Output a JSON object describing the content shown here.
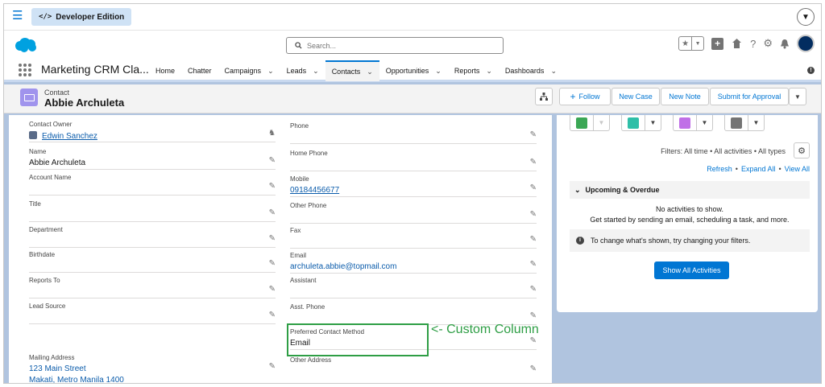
{
  "dev_bar": {
    "edition_label": "Developer Edition",
    "code_glyph": "</>"
  },
  "header": {
    "search_placeholder": "Search..."
  },
  "nav": {
    "app_name": "Marketing CRM Cla...",
    "tabs": [
      {
        "label": "Home",
        "has_menu": false,
        "active": false
      },
      {
        "label": "Chatter",
        "has_menu": false,
        "active": false
      },
      {
        "label": "Campaigns",
        "has_menu": true,
        "active": false
      },
      {
        "label": "Leads",
        "has_menu": true,
        "active": false
      },
      {
        "label": "Contacts",
        "has_menu": true,
        "active": true
      },
      {
        "label": "Opportunities",
        "has_menu": true,
        "active": false
      },
      {
        "label": "Reports",
        "has_menu": true,
        "active": false
      },
      {
        "label": "Dashboards",
        "has_menu": true,
        "active": false
      }
    ]
  },
  "record": {
    "object_label": "Contact",
    "name": "Abbie Archuleta",
    "buttons": {
      "follow": "Follow",
      "new_case": "New Case",
      "new_note": "New Note",
      "submit": "Submit for Approval"
    }
  },
  "fields": {
    "contact_owner": {
      "label": "Contact Owner",
      "value": "Edwin Sanchez"
    },
    "phone": {
      "label": "Phone",
      "value": ""
    },
    "name": {
      "label": "Name",
      "value": "Abbie Archuleta"
    },
    "home_phone": {
      "label": "Home Phone",
      "value": ""
    },
    "account_name": {
      "label": "Account Name",
      "value": ""
    },
    "mobile": {
      "label": "Mobile",
      "value": "09184456677"
    },
    "title": {
      "label": "Title",
      "value": ""
    },
    "other_phone": {
      "label": "Other Phone",
      "value": ""
    },
    "department": {
      "label": "Department",
      "value": ""
    },
    "fax": {
      "label": "Fax",
      "value": ""
    },
    "birthdate": {
      "label": "Birthdate",
      "value": ""
    },
    "email": {
      "label": "Email",
      "value": "archuleta.abbie@topmail.com"
    },
    "reports_to": {
      "label": "Reports To",
      "value": ""
    },
    "assistant": {
      "label": "Assistant",
      "value": ""
    },
    "lead_source": {
      "label": "Lead Source",
      "value": ""
    },
    "asst_phone": {
      "label": "Asst. Phone",
      "value": ""
    },
    "preferred_contact": {
      "label": "Preferred Contact Method",
      "value": "Email"
    },
    "mailing_address": {
      "label": "Mailing Address",
      "line1": "123 Main Street",
      "line2": "Makati, Metro Manila 1400"
    },
    "other_address": {
      "label": "Other Address",
      "value": ""
    }
  },
  "annotation": {
    "callout": "<- Custom Column",
    "color": "#2e9e45"
  },
  "activity": {
    "filters_text": "Filters: All time • All activities • All types",
    "refresh": "Refresh",
    "expand_all": "Expand All",
    "view_all": "View All",
    "separator": "•",
    "upcoming": "Upcoming & Overdue",
    "no_activities": "No activities to show.",
    "get_started": "Get started by sending an email, scheduling a task, and more.",
    "tip": "To change what's shown, try changing your filters.",
    "show_all": "Show All Activities",
    "action_colors": [
      "#3ba755",
      "#2fbfa8",
      "#c06fe7",
      "#747474"
    ]
  },
  "colors": {
    "brand": "#0176d3",
    "link": "#0b5cab",
    "background": "#b0c4df",
    "contact_icon": "#a094ed"
  }
}
